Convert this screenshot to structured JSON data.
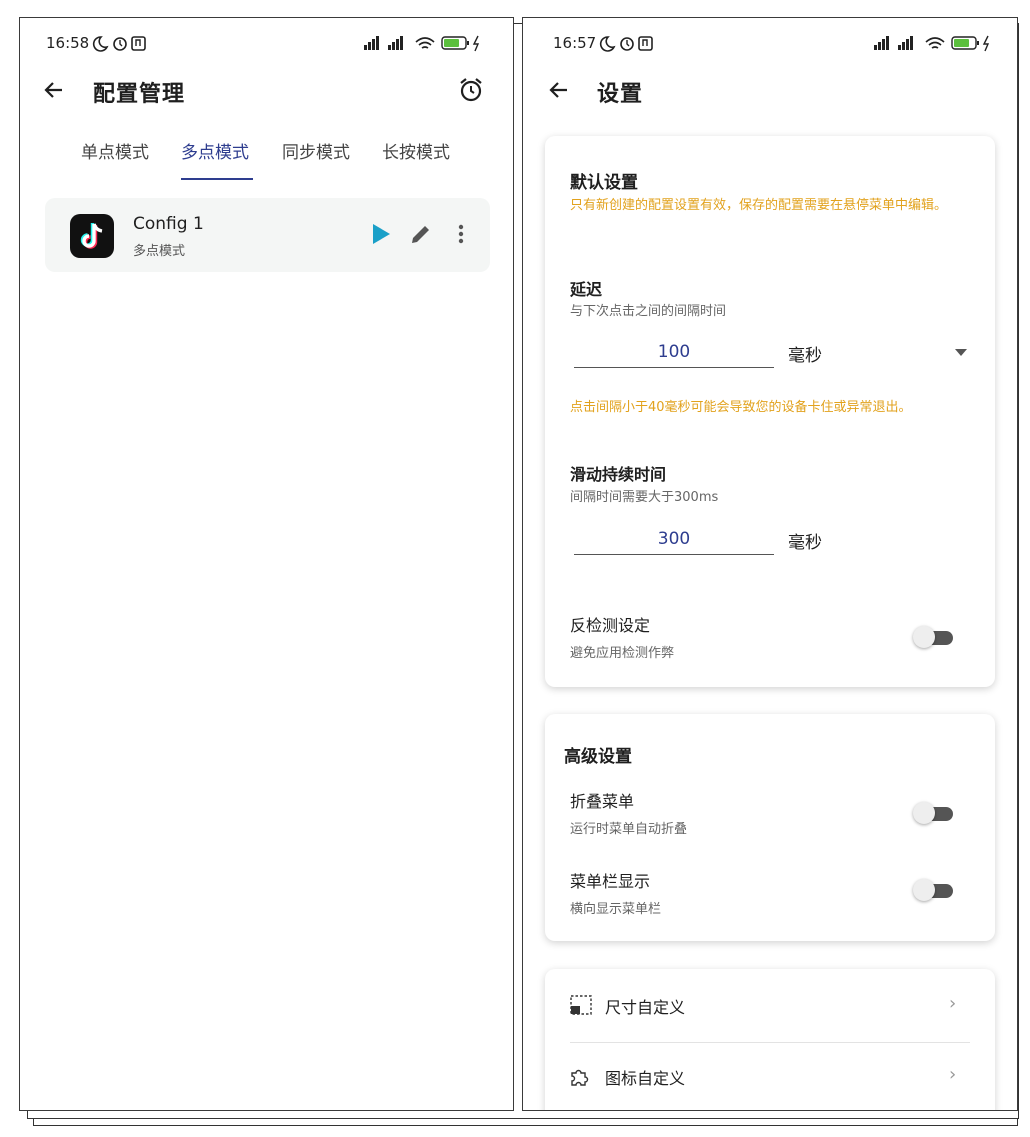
{
  "left_screen": {
    "status": {
      "time": "16:58",
      "battery": "67"
    },
    "title": "配置管理",
    "tabs": [
      "单点模式",
      "多点模式",
      "同步模式",
      "长按模式"
    ],
    "active_tab": "多点模式",
    "config": {
      "name": "Config 1",
      "mode": "多点模式"
    },
    "icons": [
      "back-arrow-icon",
      "alarm-clock-icon",
      "tiktok-app-icon",
      "play-icon",
      "edit-pencil-icon",
      "more-vert-icon"
    ]
  },
  "right_screen": {
    "status": {
      "time": "16:57",
      "battery": "66"
    },
    "title": "设置",
    "default_settings": {
      "title": "默认设置",
      "note": "只有新创建的配置设置有效，保存的配置需要在悬停菜单中编辑。",
      "delay": {
        "title": "延迟",
        "desc": "与下次点击之间的间隔时间",
        "value": "100",
        "unit": "毫秒",
        "warning": "点击间隔小于40毫秒可能会导致您的设备卡住或异常退出。"
      },
      "swipe": {
        "title": "滑动持续时间",
        "desc": "间隔时间需要大于300ms",
        "value": "300",
        "unit": "毫秒"
      },
      "anti_detect": {
        "title": "反检测设定",
        "desc": "避免应用检测作弊",
        "enabled": false
      }
    },
    "advanced_settings": {
      "title": "高级设置",
      "collapse_menu": {
        "title": "折叠菜单",
        "desc": "运行时菜单自动折叠",
        "enabled": false
      },
      "menubar_display": {
        "title": "菜单栏显示",
        "desc": "横向显示菜单栏",
        "enabled": false
      }
    },
    "custom": {
      "size": "尺寸自定义",
      "icon": "图标自定义"
    }
  },
  "colors": {
    "accent": "#2e3d8f",
    "warning": "#e2a21d",
    "play": "#1aa0c8"
  }
}
